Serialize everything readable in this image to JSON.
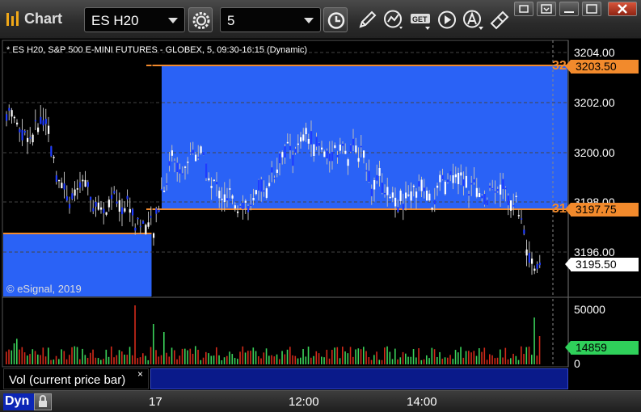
{
  "toolbar": {
    "app_title": "Chart",
    "symbol": "ES H20",
    "interval": "5",
    "icons": [
      "settings-gear-icon",
      "clock-icon",
      "pencil-draw-icon",
      "study-icon",
      "get-data-icon",
      "play-icon",
      "alert-icon",
      "link-icon"
    ],
    "window_buttons": [
      "restore-icon",
      "dock-icon",
      "maximize-icon",
      "close-icon"
    ]
  },
  "chart": {
    "header": "* ES H20, S&P 500 E-MINI FUTURES - GLOBEX, 5, 09:30-16:15 (Dynamic)",
    "copyright": "© eSignal, 2019",
    "y_axis_labels": [
      "3204.00",
      "3202.00",
      "3200.00",
      "3198.00",
      "3196.00"
    ],
    "price_tags": {
      "upper_zone": "3203.50",
      "lower_zone": "3197.75",
      "last_price": "3195.50"
    },
    "zone_counts": {
      "upper": "32",
      "lower": "31"
    },
    "colors": {
      "zone_fill": "#2a62f6",
      "zone_line": "#f28a2c",
      "up_candle": "#ffffff",
      "down_candle": "#1f3cff",
      "vol_up": "#3bd35a",
      "vol_down": "#d42a1a"
    }
  },
  "volume": {
    "label": "Vol (current price bar)",
    "close_label": "×",
    "y_axis_labels": [
      "50000",
      "0"
    ],
    "current_value": "14859"
  },
  "x_axis": {
    "labels": [
      "17",
      "12:00",
      "14:00"
    ]
  },
  "bottom_bar": {
    "mode": "Dyn"
  }
}
